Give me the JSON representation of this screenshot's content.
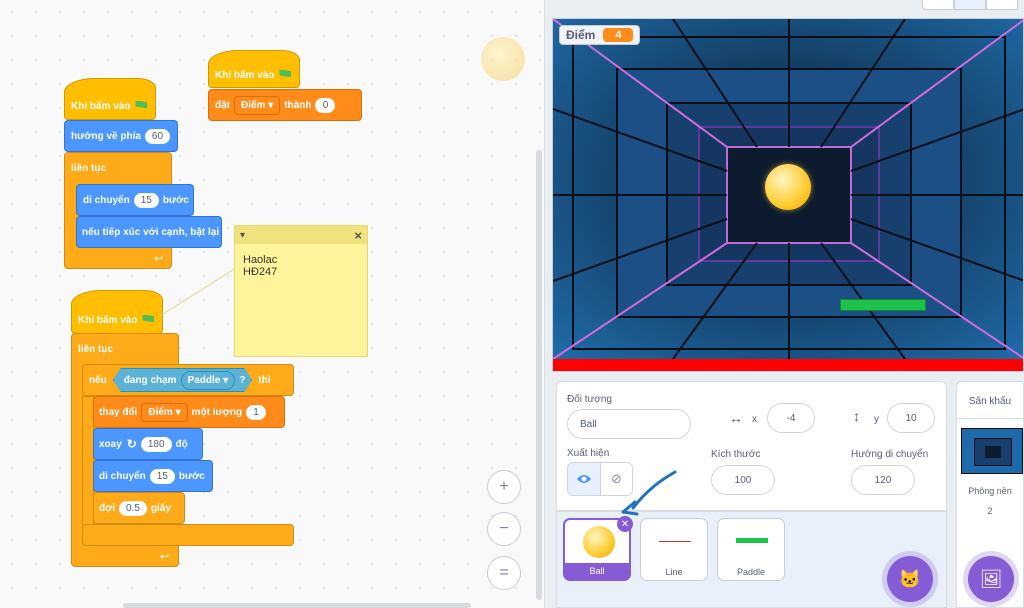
{
  "scripts": {
    "s1": {
      "hat": "Khi bấm vào",
      "set_label": "đặt",
      "set_var": "Điểm",
      "set_to": "thành",
      "set_value": "0"
    },
    "s2": {
      "hat": "Khi bấm vào",
      "point": "hướng về phía",
      "point_value": "60",
      "forever": "liên tục",
      "move": "di chuyển",
      "move_value": "15",
      "move_unit": "bước",
      "bounce": "nếu tiếp xúc với cạnh, bật lại"
    },
    "s3": {
      "hat": "Khi bấm vào",
      "forever": "liên tục",
      "if": "nếu",
      "touching": "đang chạm",
      "touch_target": "Paddle",
      "q": "?",
      "then": "thì",
      "change": "thay đổi",
      "change_var": "Điểm",
      "change_by": "một lượng",
      "change_value": "1",
      "turn": "xoay",
      "turn_value": "180",
      "turn_unit": "độ",
      "move": "di chuyển",
      "move_value": "15",
      "move_unit": "bước",
      "wait": "đợi",
      "wait_value": "0.5",
      "wait_unit": "giây"
    }
  },
  "note": {
    "text": "Haolac\nHĐ247",
    "close": "×",
    "collapse": "▾"
  },
  "zoom": {
    "in": "+",
    "out": "−",
    "reset": "="
  },
  "stage": {
    "monitor_label": "Điểm",
    "monitor_value": "4"
  },
  "sprite_info": {
    "sprite_label": "Đối tượng",
    "sprite_name": "Ball",
    "x_label": "x",
    "x_value": "-4",
    "y_label": "y",
    "y_value": "10",
    "show_label": "Xuất hiện",
    "size_label": "Kích thước",
    "size_value": "100",
    "direction_label": "Hướng di chuyển",
    "direction_value": "120"
  },
  "sprites": [
    {
      "name": "Ball"
    },
    {
      "name": "Line"
    },
    {
      "name": "Paddle"
    }
  ],
  "stage_panel": {
    "title": "Sân khấu",
    "backdrops_label": "Phông nền",
    "backdrops_count": "2"
  },
  "colors": {
    "events": "#ffbf00",
    "motion": "#4c97ff",
    "control": "#ffab19",
    "variables": "#ff8c1a",
    "sensing": "#5cb1d6",
    "accent": "#855cd6"
  }
}
